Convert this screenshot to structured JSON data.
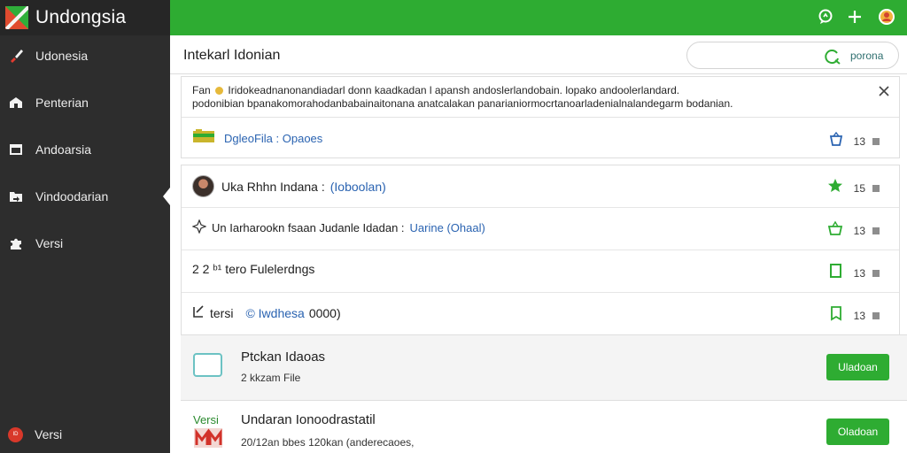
{
  "app": {
    "title": "Undongsia"
  },
  "sidebar": {
    "items": [
      {
        "label": "Udonesia",
        "icon": "brush-icon",
        "active": false
      },
      {
        "label": "Penterian",
        "icon": "building-icon",
        "active": false
      },
      {
        "label": "Andoarsia",
        "icon": "window-icon",
        "active": false
      },
      {
        "label": "Vindoodarian",
        "icon": "folder-arrow-icon",
        "active": true
      },
      {
        "label": "Versi",
        "icon": "puzzle-icon",
        "active": false
      }
    ],
    "footer": {
      "label": "Versi",
      "avatar_text": "ID"
    }
  },
  "topbar": {
    "icons": [
      "chat-icon",
      "plus-icon",
      "user-badge-icon"
    ]
  },
  "header": {
    "title": "Intekarl Idonian",
    "search_placeholder": "porona"
  },
  "notice": {
    "prefix": "Fan",
    "line1": "Iridokeadnanonandiadarl donn kaadkadan l apansh andoslerlandobain. lopako andoolerlandard.",
    "line2": "podonibian bpanakomorahodanbabainaitonana anatcalakan panarianiormocrtanoarladenialnalandegarm bodanian.",
    "link": "DgleoFila : Opaoes",
    "count": "13"
  },
  "list": {
    "rows": [
      {
        "text": "Uka Rhhn Indana :",
        "link": "(Ioboolan)",
        "count": "15",
        "icon": "star-icon",
        "lead_icon": "profile-photo"
      },
      {
        "text": "Un Iarharookn fsaan Judanle Idadan :",
        "link": "Uarine (Ohaal)",
        "count": "13",
        "icon": "basket-icon",
        "lead_icon": "sparkle-icon"
      },
      {
        "text": "2 2 ᵇ¹ tero Fulelerdngs",
        "link": "",
        "count": "13",
        "icon": "square-icon",
        "lead_icon": ""
      },
      {
        "text": "tersi",
        "link": "© Iwdhesa",
        "link_tail": "0000)",
        "count": "13",
        "icon": "bookmark-icon",
        "lead_icon": "check-icon"
      }
    ]
  },
  "files": [
    {
      "title": "Ptckan Idaoas",
      "subtitle": "2 kkzam File",
      "button": "Uladoan",
      "icon": "outline-rect-icon"
    },
    {
      "title": "Undaran Ionoodrastatil",
      "subtitle": "20/12an bbes 120kan (anderecaoes,",
      "button": "Oladoan",
      "brand_text": "Versi",
      "icon": "red-logo-icon"
    }
  ],
  "colors": {
    "accent": "#2eac32",
    "sidebar": "#2d2d2d",
    "link": "#2a63b1",
    "danger": "#d8382a"
  }
}
